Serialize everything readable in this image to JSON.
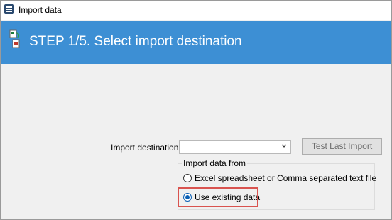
{
  "window": {
    "title": "Import data"
  },
  "banner": {
    "title": "STEP 1/5. Select import destination"
  },
  "form": {
    "import_destination_label": "Import destination",
    "import_destination_value": "",
    "test_button_label": "Test Last Import",
    "group_label": "Import data from",
    "options": [
      {
        "label": "Excel spreadsheet or Comma separated text file",
        "selected": false
      },
      {
        "label": "Use existing data",
        "selected": true
      }
    ]
  },
  "colors": {
    "banner": "#3d8fd4",
    "highlight": "#d9534f",
    "radio_selected": "#0a5fb4"
  }
}
